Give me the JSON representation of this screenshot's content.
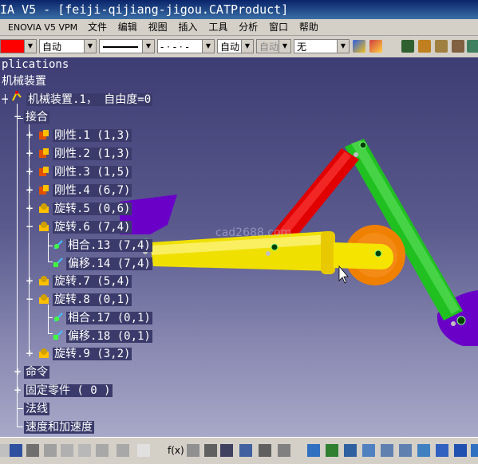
{
  "window": {
    "title": "IA V5 - [feiji-qijiang-jigou.CATProduct]"
  },
  "menu": {
    "items": [
      "ENOVIA V5 VPM",
      "文件",
      "编辑",
      "视图",
      "插入",
      "工具",
      "分析",
      "窗口",
      "帮助"
    ]
  },
  "toolbar": {
    "color_combo": "",
    "transparency_combo": "自动",
    "thickness_combo": "",
    "linetype_combo": "- · - · -",
    "layer_combo": "自动",
    "rendering_combo": "自动",
    "layer_name_combo": "无"
  },
  "tree": {
    "applications": "plications",
    "root": "机械装置",
    "mechanism": "机械装置.1， 自由度=0",
    "joints": "接合",
    "items": [
      {
        "label": "刚性.1 (1,3)"
      },
      {
        "label": "刚性.2 (1,3)"
      },
      {
        "label": "刚性.3 (1,5)"
      },
      {
        "label": "刚性.4 (6,7)"
      },
      {
        "label": "旋转.5 (0,6)"
      },
      {
        "label": "旋转.6 (7,4)"
      },
      {
        "label": "相合.13 (7,4)"
      },
      {
        "label": "偏移.14 (7,4)"
      },
      {
        "label": "旋转.7 (5,4)"
      },
      {
        "label": "旋转.8 (0,1)"
      },
      {
        "label": "相合.17 (0,1)"
      },
      {
        "label": "偏移.18 (0,1)"
      },
      {
        "label": "旋转.9 (3,2)"
      }
    ],
    "commands": "命令",
    "fixed_part": "固定零件 ( 0 )",
    "laws": "法线",
    "speed_accel": "速度和加速度"
  },
  "viewport": {
    "watermark": "cad2688.com"
  },
  "colors": {
    "viewport_top": "#3d3d74",
    "viewport_bottom": "#a8a8c8",
    "yellow_part": "#f0e000",
    "red_part": "#e00000",
    "green_part": "#20c020",
    "purple_part": "#6a00c8",
    "orange_part": "#f08000"
  }
}
